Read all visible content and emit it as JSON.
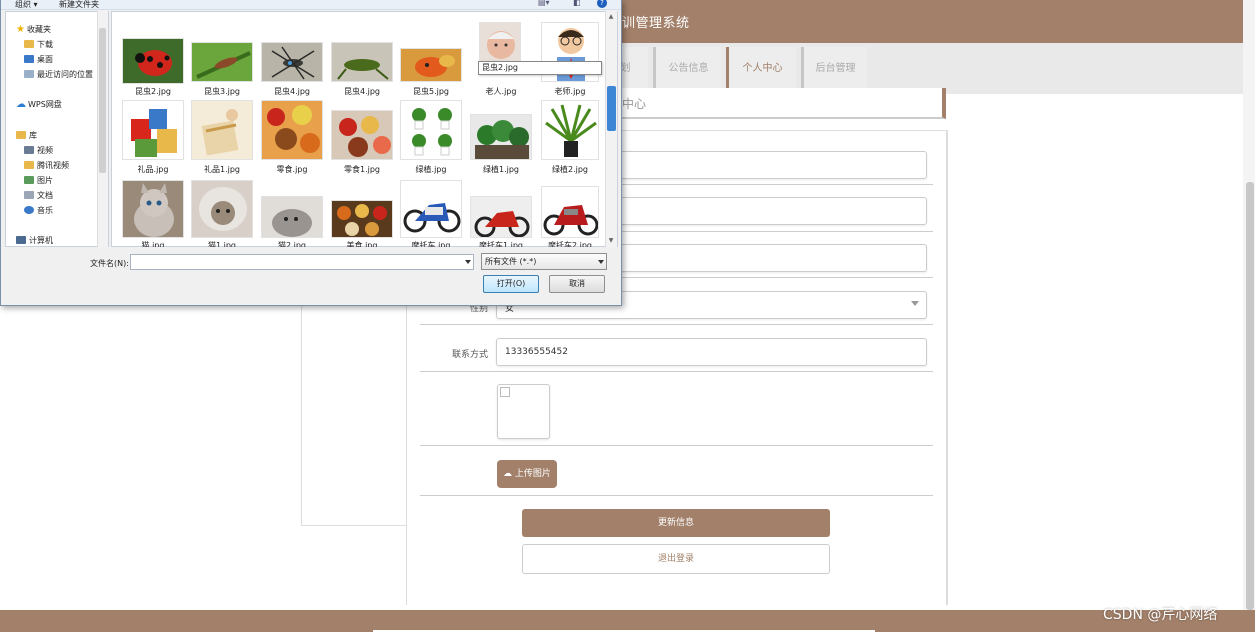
{
  "page": {
    "site_title": "训管理系统",
    "nav_items": [
      {
        "label": "划",
        "active": false
      },
      {
        "label": "公告信息",
        "active": false
      },
      {
        "label": "个人中心",
        "active": true
      },
      {
        "label": "后台管理",
        "active": false
      }
    ],
    "breadcrumb": "中心",
    "form": {
      "gender_value": "女",
      "gender_label": "性别",
      "contact_label": "联系方式",
      "contact_value": "13336555452",
      "upload_label": "上传图片",
      "update_label": "更新信息",
      "logout_label": "退出登录"
    },
    "watermark": "CSDN @芹心网络"
  },
  "colors": {
    "accent": "#a2806a",
    "dialog_blue": "#3d86d6"
  },
  "dialog": {
    "toolbar": {
      "organize": "组织 ▾",
      "new_folder": "新建文件夹"
    },
    "nav_tree": [
      {
        "label": "收藏夹",
        "icon": "star-icon"
      },
      {
        "label": "下载",
        "icon": "download-folder-icon"
      },
      {
        "label": "桌面",
        "icon": "desktop-icon"
      },
      {
        "label": "最近访问的位置",
        "icon": "recent-places-icon"
      },
      {
        "label": "WPS网盘",
        "icon": "cloud-icon"
      },
      {
        "label": "库",
        "icon": "library-icon"
      },
      {
        "label": "视频",
        "icon": "video-icon"
      },
      {
        "label": "腾讯视频",
        "icon": "tencent-video-icon"
      },
      {
        "label": "图片",
        "icon": "pictures-icon"
      },
      {
        "label": "文档",
        "icon": "documents-icon"
      },
      {
        "label": "音乐",
        "icon": "music-icon"
      },
      {
        "label": "计算机",
        "icon": "computer-icon"
      }
    ],
    "files": [
      {
        "name": "昆虫2.jpg"
      },
      {
        "name": "昆虫3.jpg"
      },
      {
        "name": "昆虫4.jpg"
      },
      {
        "name": "昆虫4.jpg"
      },
      {
        "name": "昆虫5.jpg"
      },
      {
        "name": "老人.jpg"
      },
      {
        "name": "老师.jpg"
      },
      {
        "name": "礼品.jpg"
      },
      {
        "name": "礼品1.jpg"
      },
      {
        "name": "零食.jpg"
      },
      {
        "name": "零食1.jpg"
      },
      {
        "name": "绿植.jpg"
      },
      {
        "name": "绿植1.jpg"
      },
      {
        "name": "绿植2.jpg"
      },
      {
        "name": "猫.jpg"
      },
      {
        "name": "猫1.jpg"
      },
      {
        "name": "猫2.jpg"
      },
      {
        "name": "美食.jpg"
      },
      {
        "name": "摩托车.jpg"
      },
      {
        "name": "摩托车1.jpg"
      },
      {
        "name": "摩托车2.jpg"
      }
    ],
    "tooltip": "昆虫2.jpg",
    "filename_label": "文件名(N):",
    "filename_value": "",
    "filetype_value": "所有文件 (*.*)",
    "open_label": "打开(O)",
    "cancel_label": "取消"
  }
}
